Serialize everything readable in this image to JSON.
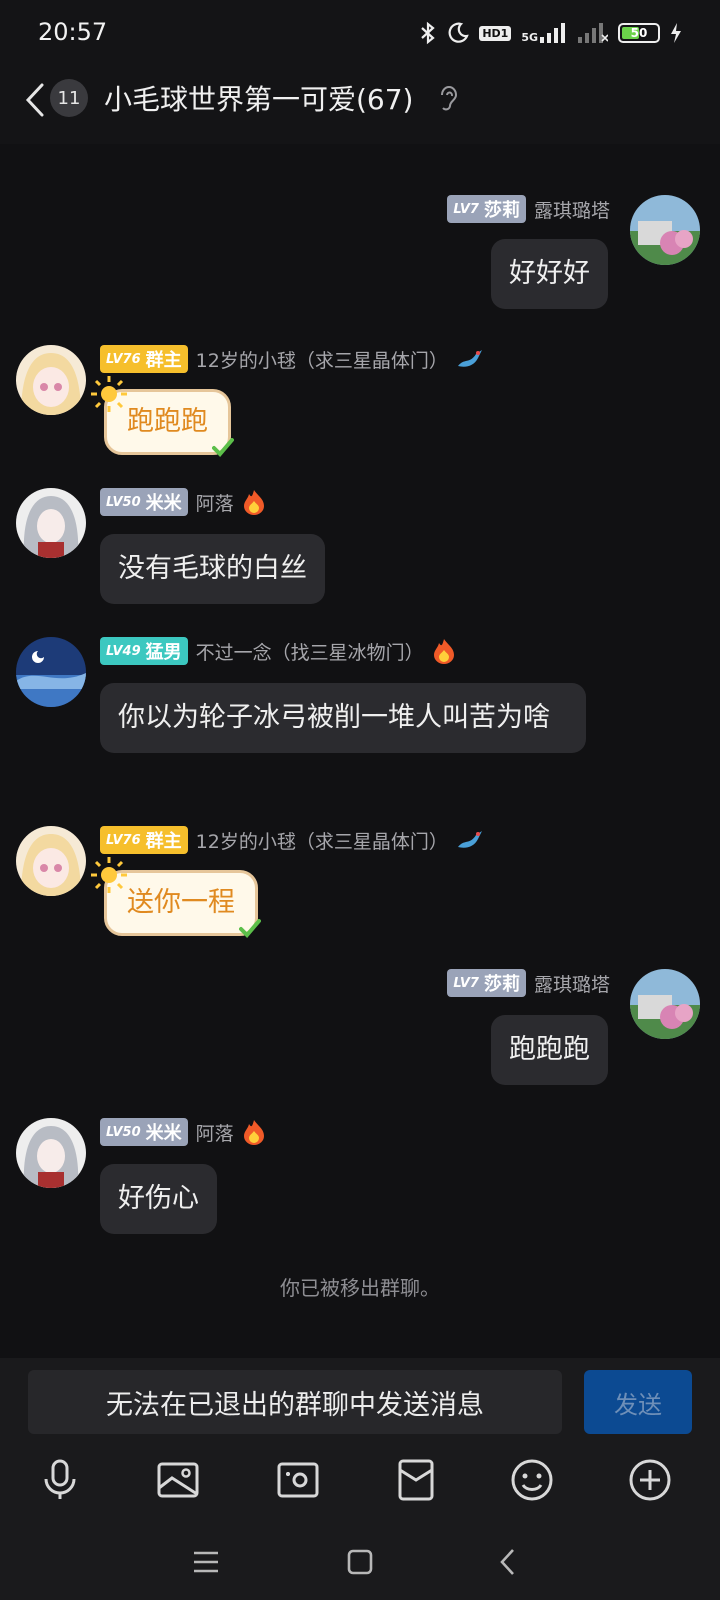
{
  "status": {
    "time": "20:57",
    "hd_label": "HD1",
    "network": "5G",
    "battery": "50"
  },
  "header": {
    "unread": "11",
    "title": "小毛球世界第一可爱(67)"
  },
  "messages": [
    {
      "side": "right",
      "level": "LV7",
      "title": "莎莉",
      "title_color": "#9aa3b8",
      "name": "露琪璐塔",
      "text": "好好好"
    },
    {
      "side": "left",
      "level": "LV76",
      "title": "群主",
      "title_color": "#f6bf2c",
      "name": "12岁的小毬（求三星晶体门）",
      "text": "跑跑跑",
      "style": "fancy"
    },
    {
      "side": "left",
      "level": "LV50",
      "title": "米米",
      "title_color": "#9aa3b8",
      "name": "阿落",
      "text": "没有毛球的白丝"
    },
    {
      "side": "left",
      "level": "LV49",
      "title": "猛男",
      "title_color": "#3cc8c0",
      "name": "不过一念（找三星冰物门）",
      "text": "你以为轮子冰弓被削一堆人叫苦为啥"
    },
    {
      "side": "left",
      "level": "LV76",
      "title": "群主",
      "title_color": "#f6bf2c",
      "name": "12岁的小毬（求三星晶体门）",
      "text": "送你一程",
      "style": "fancy"
    },
    {
      "side": "right",
      "level": "LV7",
      "title": "莎莉",
      "title_color": "#9aa3b8",
      "name": "露琪璐塔",
      "text": "跑跑跑"
    },
    {
      "side": "left",
      "level": "LV50",
      "title": "米米",
      "title_color": "#9aa3b8",
      "name": "阿落",
      "text": "好伤心"
    }
  ],
  "system_message": "你已被移出群聊。",
  "input": {
    "placeholder": "无法在已退出的群聊中发送消息",
    "send_label": "发送"
  },
  "toolbar_icons": [
    "microphone-icon",
    "image-icon",
    "camera-icon",
    "red-packet-icon",
    "emoji-icon",
    "plus-icon"
  ],
  "nav_icons": [
    "menu-icon",
    "home-icon",
    "back-icon"
  ]
}
